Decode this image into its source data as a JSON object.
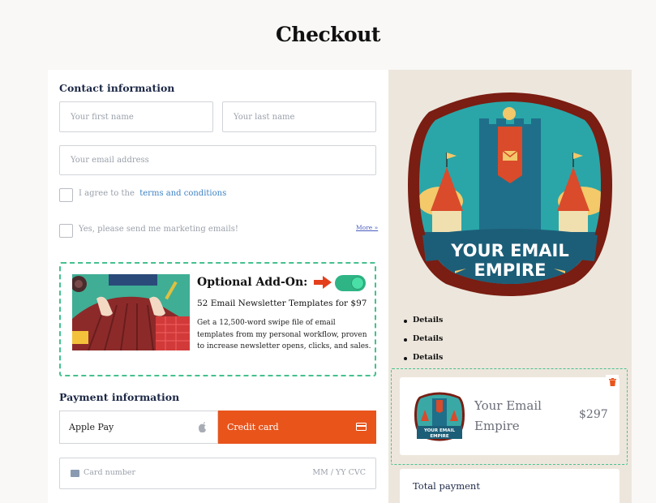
{
  "page": {
    "title": "Checkout"
  },
  "contact": {
    "title": "Contact information",
    "first_name_placeholder": "Your first name",
    "last_name_placeholder": "Your last name",
    "email_placeholder": "Your email address",
    "terms_prefix": "I agree to the",
    "terms_link": "terms and conditions",
    "marketing_label": "Yes, please send me marketing emails!",
    "more_link": "More »"
  },
  "addon": {
    "title": "Optional Add-On:",
    "subtitle": "52 Email Newsletter Templates for $97",
    "description": "Get a 12,500-word swipe file of email templates from my personal workflow, proven to increase newsletter opens, clicks, and sales.",
    "toggle_on": true
  },
  "payment": {
    "title": "Payment information",
    "apple_pay_label": "Apple Pay",
    "credit_card_label": "Credit card",
    "card_number_placeholder": "Card number",
    "expiry_cvc_placeholder": "MM / YY  CVC"
  },
  "summary": {
    "badge_line1": "YOUR EMAIL",
    "badge_line2": "EMPIRE",
    "details": [
      "Details",
      "Details",
      "Details"
    ],
    "product_name": "Your Email Empire",
    "product_price": "$297",
    "total_label": "Total payment",
    "thumb_line1": "YOUR EMAIL",
    "thumb_line2": "EMPIRE"
  },
  "colors": {
    "accent": "#e9541b",
    "toggle": "#2fb486",
    "dashed_border": "#45c08e",
    "link": "#3e82c4",
    "right_panel_bg": "#ede6dc"
  }
}
